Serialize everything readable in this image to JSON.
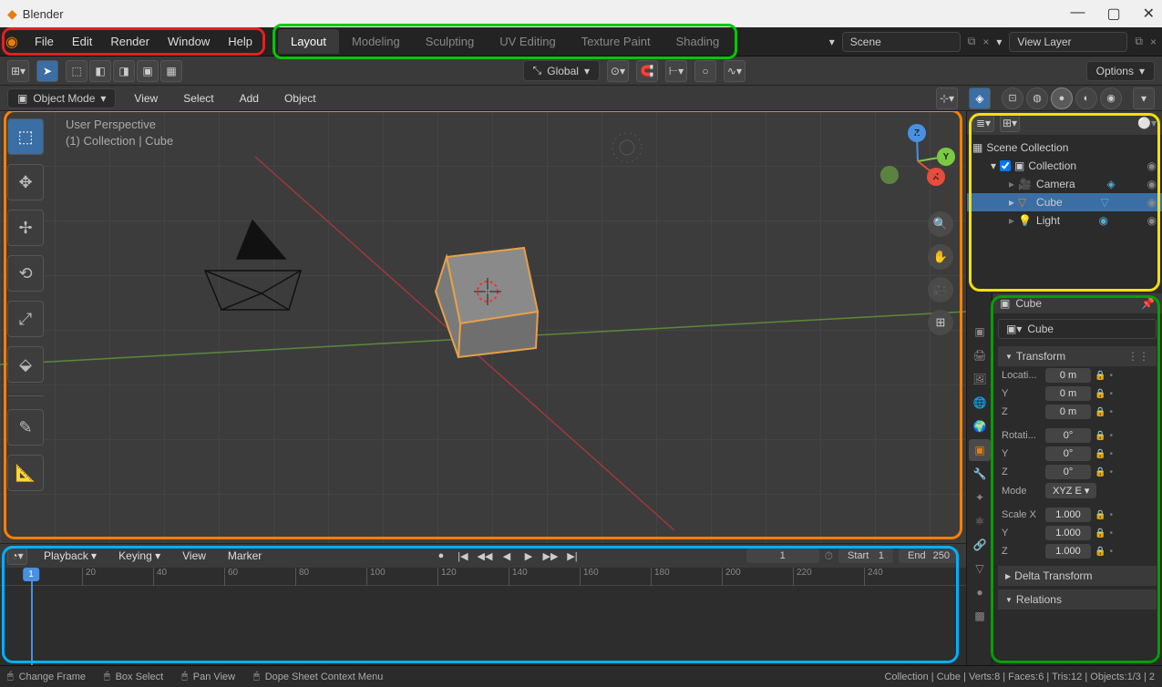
{
  "window": {
    "title": "Blender"
  },
  "menu": {
    "file": "File",
    "edit": "Edit",
    "render": "Render",
    "window": "Window",
    "help": "Help"
  },
  "workspaces": [
    "Layout",
    "Modeling",
    "Sculpting",
    "UV Editing",
    "Texture Paint",
    "Shading"
  ],
  "scene_selector": {
    "scene": "Scene",
    "view_layer": "View Layer"
  },
  "header2": {
    "global": "Global",
    "options": "Options"
  },
  "mode_header": {
    "mode": "Object Mode",
    "view": "View",
    "select": "Select",
    "add": "Add",
    "object": "Object"
  },
  "viewport": {
    "label1": "User Perspective",
    "label2": "(1) Collection | Cube"
  },
  "timeline": {
    "playback": "Playback",
    "keying": "Keying",
    "view": "View",
    "marker": "Marker",
    "current": "1",
    "start_label": "Start",
    "start": "1",
    "end_label": "End",
    "end": "250",
    "ticks": [
      "20",
      "40",
      "60",
      "80",
      "100",
      "120",
      "140",
      "160",
      "180",
      "200",
      "220",
      "240"
    ]
  },
  "outliner": {
    "root": "Scene Collection",
    "collection": "Collection",
    "items": [
      {
        "name": "Camera",
        "type": "camera"
      },
      {
        "name": "Cube",
        "type": "mesh"
      },
      {
        "name": "Light",
        "type": "light"
      }
    ]
  },
  "properties": {
    "header_crumb": "Cube",
    "name": "Cube",
    "transform_title": "Transform",
    "location_label": "Locati...",
    "rotation_label": "Rotati...",
    "mode_label": "Mode",
    "mode_value": "XYZ E",
    "scale_label": "Scale X",
    "loc": {
      "x": "0 m",
      "y": "0 m",
      "z": "0 m"
    },
    "rot": {
      "x": "0°",
      "y": "0°",
      "z": "0°"
    },
    "scale": {
      "x": "1.000",
      "y": "1.000",
      "z": "1.000"
    },
    "axis": {
      "y": "Y",
      "z": "Z"
    },
    "delta": "Delta Transform",
    "relations": "Relations"
  },
  "status": {
    "change_frame": "Change Frame",
    "box_select": "Box Select",
    "pan_view": "Pan View",
    "context_menu": "Dope Sheet Context Menu",
    "stats": "Collection | Cube | Verts:8 | Faces:6 | Tris:12 | Objects:1/3 | 2"
  }
}
